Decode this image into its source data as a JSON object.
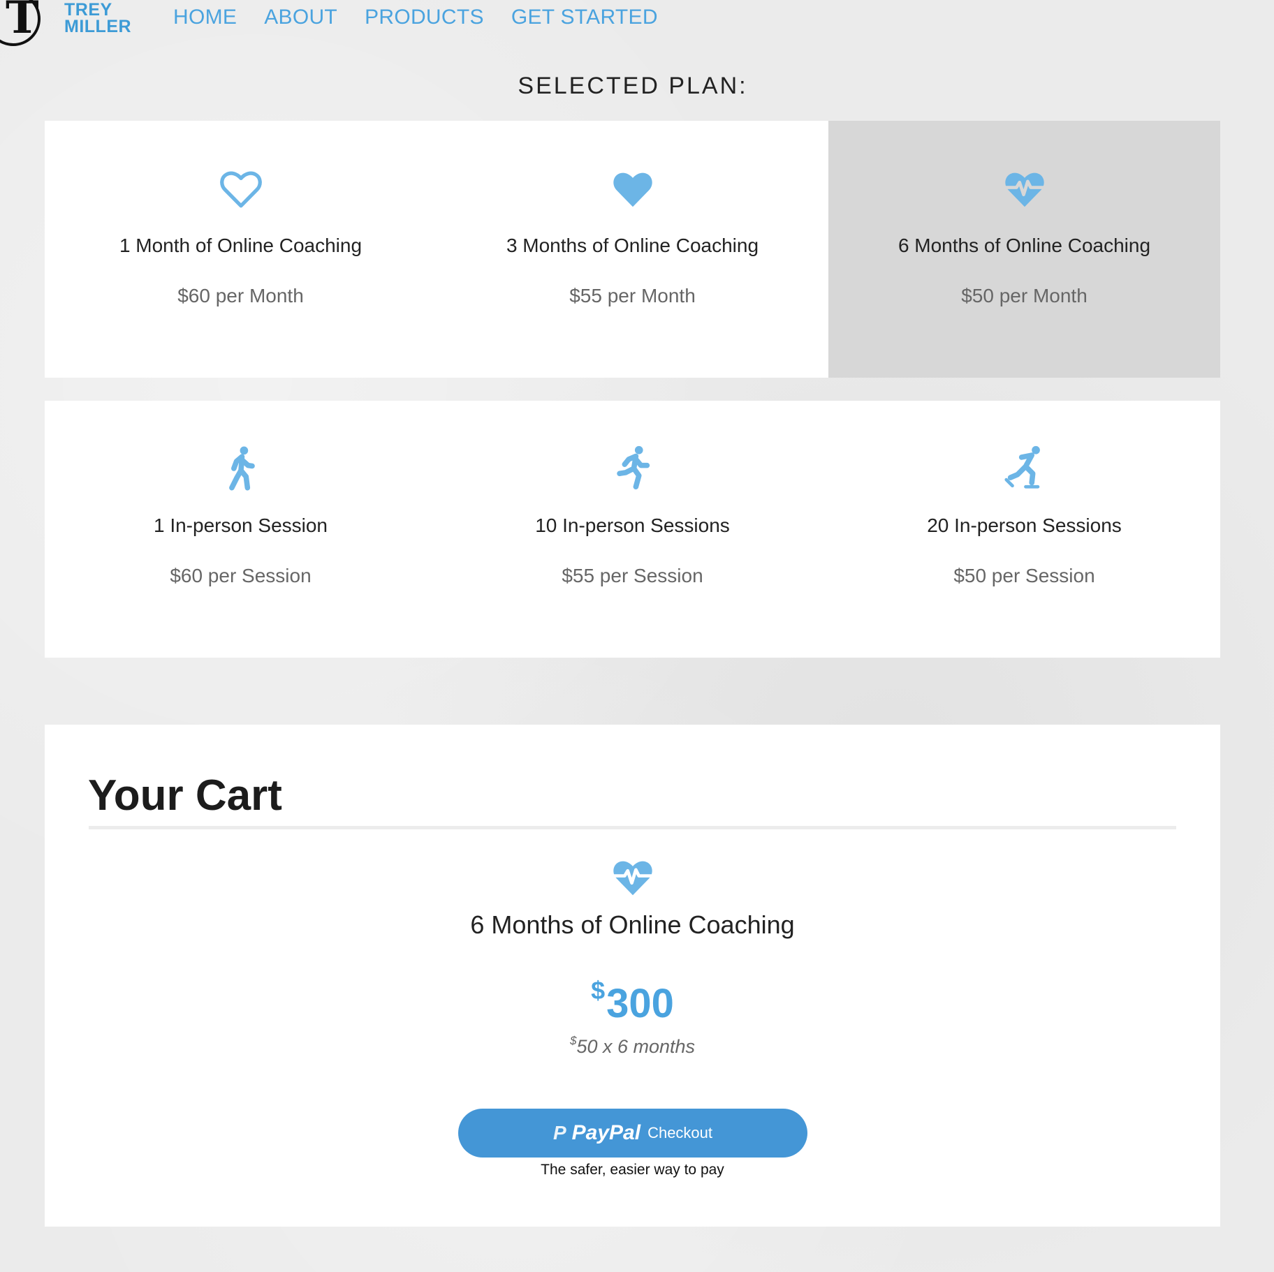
{
  "brand": {
    "logo_letter": "T",
    "line1": "TREY",
    "line2": "MILLER"
  },
  "nav": {
    "items": [
      {
        "label": "HOME"
      },
      {
        "label": "ABOUT"
      },
      {
        "label": "PRODUCTS"
      },
      {
        "label": "GET STARTED"
      }
    ]
  },
  "selected_title": "SELECTED PLAN:",
  "plans": [
    {
      "name": "1 Month of Online Coaching",
      "price": "$60 per Month",
      "icon": "heart-outline-icon",
      "selected": false
    },
    {
      "name": "3 Months of Online Coaching",
      "price": "$55 per Month",
      "icon": "heart-icon",
      "selected": false
    },
    {
      "name": "6 Months of Online Coaching",
      "price": "$50 per Month",
      "icon": "heartbeat-icon",
      "selected": true
    },
    {
      "name": "1 In-person Session",
      "price": "$60 per Session",
      "icon": "walking-icon",
      "selected": false
    },
    {
      "name": "10 In-person Sessions",
      "price": "$55 per Session",
      "icon": "running-icon",
      "selected": false
    },
    {
      "name": "20 In-person Sessions",
      "price": "$50 per Session",
      "icon": "skating-icon",
      "selected": false
    }
  ],
  "cart": {
    "title": "Your Cart",
    "icon": "heartbeat-icon",
    "item_name": "6 Months of Online Coaching",
    "currency": "$",
    "total": "300",
    "breakdown": "50 x 6 months",
    "paypal": {
      "mark": "P",
      "word": "PayPal",
      "label": "Checkout",
      "tagline": "The safer, easier way to pay"
    }
  },
  "colors": {
    "accent": "#4aa3df",
    "icon": "#6cb5e6",
    "selected_bg": "#d7d7d7",
    "paypal": "#4496d6"
  }
}
